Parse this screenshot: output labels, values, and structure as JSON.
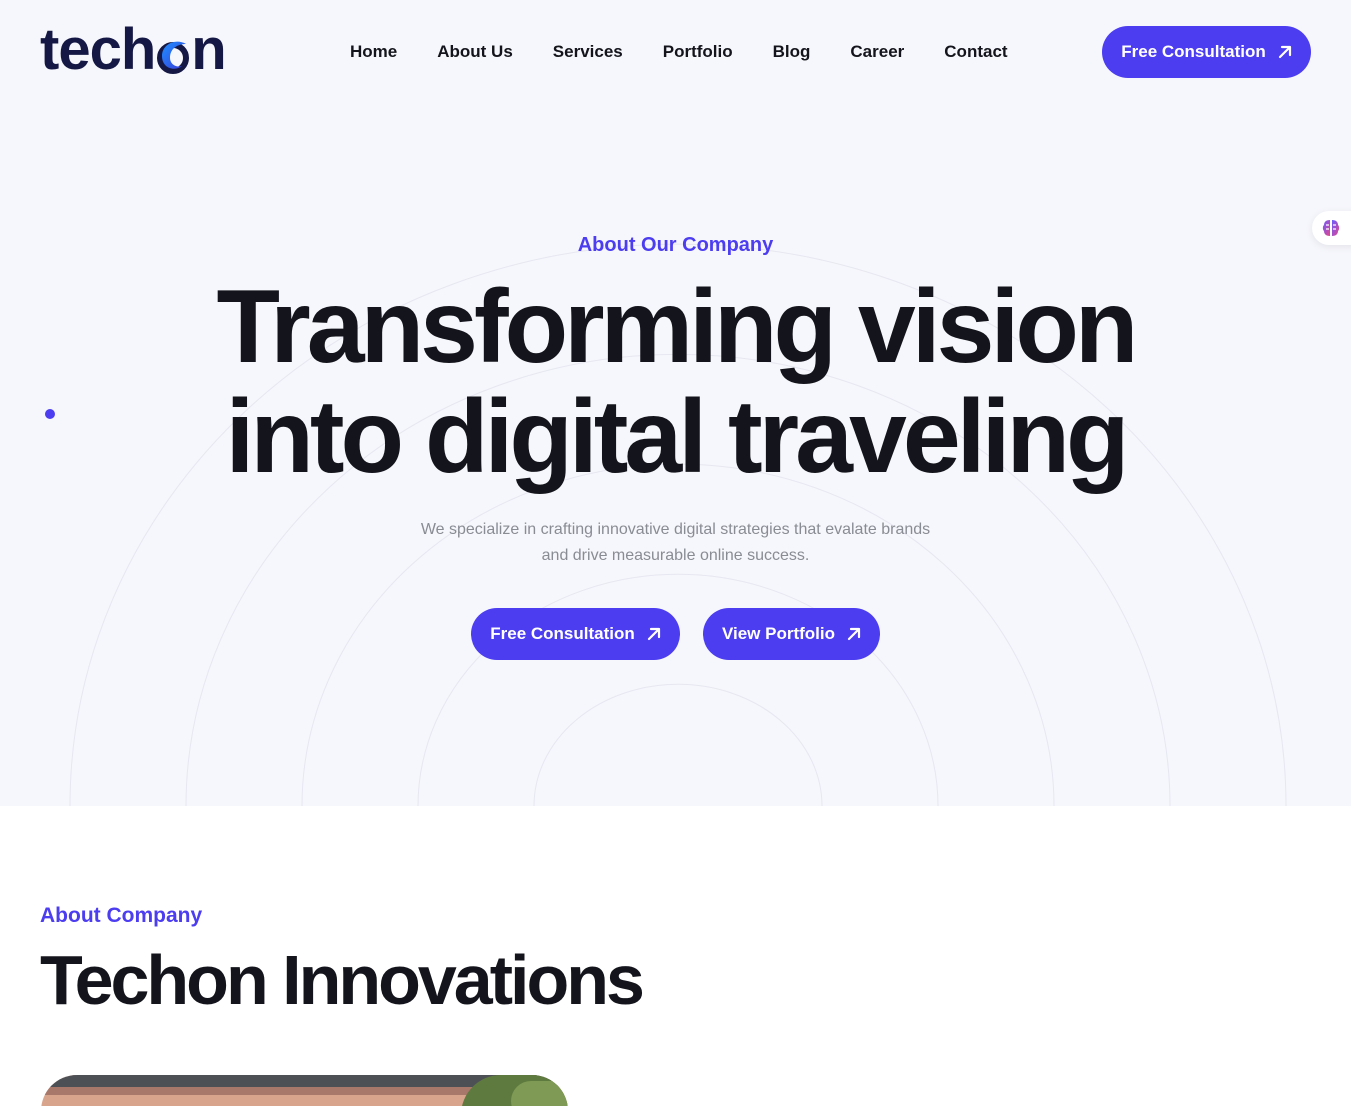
{
  "brand": {
    "name_prefix": "tech",
    "name_suffix": "n",
    "accent": "#4c3df0",
    "dark": "#151845"
  },
  "nav": {
    "items": [
      {
        "label": "Home"
      },
      {
        "label": "About Us"
      },
      {
        "label": "Services"
      },
      {
        "label": "Portfolio"
      },
      {
        "label": "Blog"
      },
      {
        "label": "Career"
      },
      {
        "label": "Contact"
      }
    ],
    "cta_label": "Free Consultation",
    "cta_icon": "arrow-up-right-icon"
  },
  "side_widget": {
    "icon": "brain-icon"
  },
  "hero": {
    "eyebrow": "About Our Company",
    "headline_line1": "Transforming vision",
    "headline_line2": "into digital traveling",
    "subtext_line1": "We specialize in crafting innovative digital strategies that evalate brands",
    "subtext_line2": "and drive measurable online success.",
    "primary_label": "Free Consultation",
    "secondary_label": "View Portfolio"
  },
  "about": {
    "eyebrow": "About Company",
    "title": "Techon Innovations"
  }
}
